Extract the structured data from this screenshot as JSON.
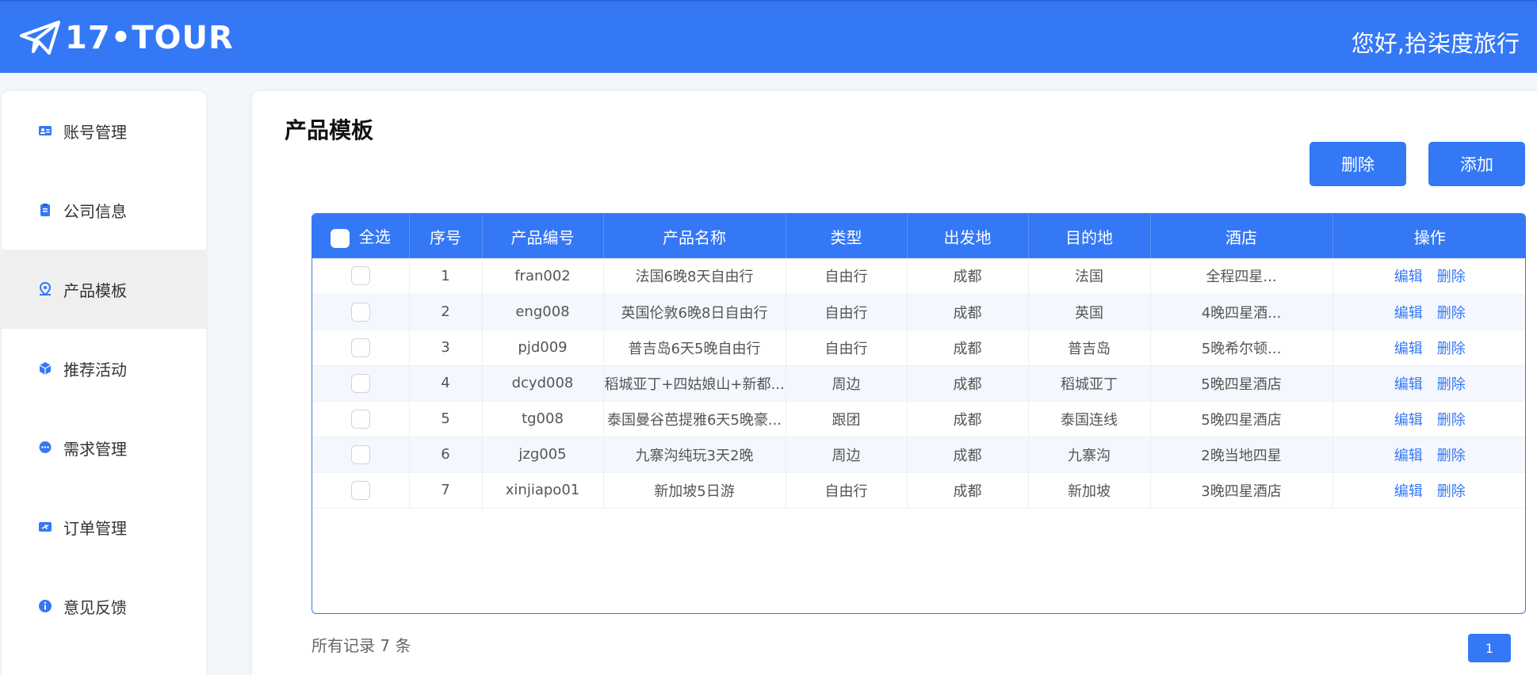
{
  "header": {
    "logo_text": "17•TOUR",
    "greeting": "您好,拾柒度旅行"
  },
  "sidebar": {
    "items": [
      {
        "label": "账号管理",
        "icon": "id-card-icon"
      },
      {
        "label": "公司信息",
        "icon": "clipboard-icon"
      },
      {
        "label": "产品模板",
        "icon": "location-pin-icon",
        "active": true
      },
      {
        "label": "推荐活动",
        "icon": "cube-icon"
      },
      {
        "label": "需求管理",
        "icon": "chat-bubble-icon"
      },
      {
        "label": "订单管理",
        "icon": "ticket-icon"
      },
      {
        "label": "意见反馈",
        "icon": "info-icon"
      }
    ]
  },
  "main": {
    "title": "产品模板",
    "delete_label": "删除",
    "add_label": "添加",
    "columns": [
      "全选",
      "序号",
      "产品编号",
      "产品名称",
      "类型",
      "出发地",
      "目的地",
      "酒店",
      "操作"
    ],
    "rows": [
      {
        "no": "1",
        "code": "fran002",
        "name": "法国6晚8天自由行",
        "type": "自由行",
        "from": "成都",
        "to": "法国",
        "hotel": "全程四星...",
        "edit": "编辑",
        "delete": "删除"
      },
      {
        "no": "2",
        "code": "eng008",
        "name": "英国伦敦6晚8日自由行",
        "type": "自由行",
        "from": "成都",
        "to": "英国",
        "hotel": "4晚四星酒...",
        "edit": "编辑",
        "delete": "删除"
      },
      {
        "no": "3",
        "code": "pjd009",
        "name": "普吉岛6天5晚自由行",
        "type": "自由行",
        "from": "成都",
        "to": "普吉岛",
        "hotel": "5晚希尔顿...",
        "edit": "编辑",
        "delete": "删除"
      },
      {
        "no": "4",
        "code": "dcyd008",
        "name": "稻城亚丁+四姑娘山+新都...",
        "type": "周边",
        "from": "成都",
        "to": "稻城亚丁",
        "hotel": "5晚四星酒店",
        "edit": "编辑",
        "delete": "删除"
      },
      {
        "no": "5",
        "code": "tg008",
        "name": "泰国曼谷芭提雅6天5晚豪...",
        "type": "跟团",
        "from": "成都",
        "to": "泰国连线",
        "hotel": "5晚四星酒店",
        "edit": "编辑",
        "delete": "删除"
      },
      {
        "no": "6",
        "code": "jzg005",
        "name": "九寨沟纯玩3天2晚",
        "type": "周边",
        "from": "成都",
        "to": "九寨沟",
        "hotel": "2晚当地四星",
        "edit": "编辑",
        "delete": "删除"
      },
      {
        "no": "7",
        "code": "xinjiapo01",
        "name": "新加坡5日游",
        "type": "自由行",
        "from": "成都",
        "to": "新加坡",
        "hotel": "3晚四星酒店",
        "edit": "编辑",
        "delete": "删除"
      }
    ],
    "total_text": "所有记录 7 条",
    "current_page": "1"
  },
  "colors": {
    "brand": "#3478f6",
    "active_sidebar_bg": "#efefef"
  }
}
